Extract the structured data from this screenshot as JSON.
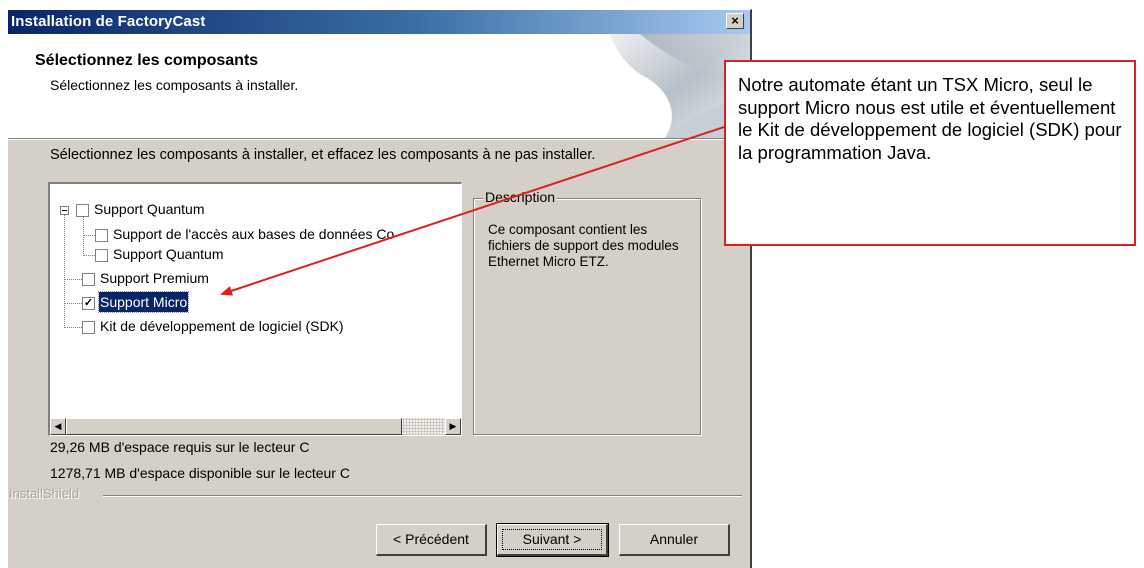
{
  "window": {
    "title": "Installation de FactoryCast",
    "close_glyph": "×"
  },
  "header": {
    "title": "Sélectionnez les composants",
    "subtitle": "Sélectionnez les composants à installer."
  },
  "instruction": "Sélectionnez les composants à installer, et effacez les composants à ne pas installer.",
  "tree": {
    "items": [
      {
        "label": "Support Quantum",
        "level": 0,
        "checked": false,
        "expander": "minus"
      },
      {
        "label": "Support de l'accès aux bases de données Co",
        "level": 1,
        "checked": false
      },
      {
        "label": "Support Quantum",
        "level": 1,
        "checked": false
      },
      {
        "label": "Support Premium",
        "level": 0,
        "checked": false
      },
      {
        "label": "Support Micro",
        "level": 0,
        "checked": true,
        "selected": true
      },
      {
        "label": "Kit de développement de logiciel (SDK)",
        "level": 0,
        "checked": false
      }
    ],
    "check_glyph": "✓",
    "scroll_left": "◀",
    "scroll_right": "▶"
  },
  "description": {
    "legend": "Description",
    "text": "Ce composant contient les fichiers de support des modules Ethernet Micro ETZ."
  },
  "space": {
    "required": "29,26 MB d'espace requis sur le lecteur C",
    "available": "1278,71 MB d'espace disponible sur le lecteur C"
  },
  "brand": "InstallShield",
  "buttons": {
    "back": "< Précédent",
    "next": "Suivant >",
    "cancel": "Annuler"
  },
  "callout": {
    "text": "Notre automate étant un TSX Micro, seul le support Micro nous est utile et éventuellement le Kit de développement de logiciel (SDK) pour la programmation Java."
  },
  "colors": {
    "titlebar_start": "#0a246a",
    "dialog_face": "#d4d0c8",
    "selection": "#0a246a",
    "callout_border": "#e02020"
  }
}
